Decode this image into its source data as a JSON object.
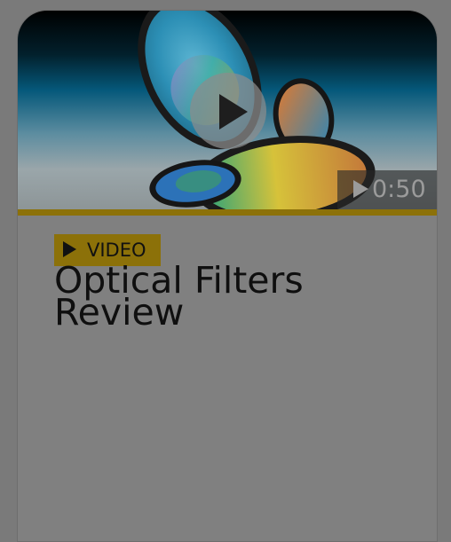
{
  "video": {
    "duration": "0:50",
    "badge_label": "VIDEO",
    "title": "Optical Filters Review"
  },
  "colors": {
    "accent": "#8c7109",
    "overlay": "#7a7a7a"
  },
  "icons": {
    "play": "play-icon",
    "badge": "play-icon"
  }
}
